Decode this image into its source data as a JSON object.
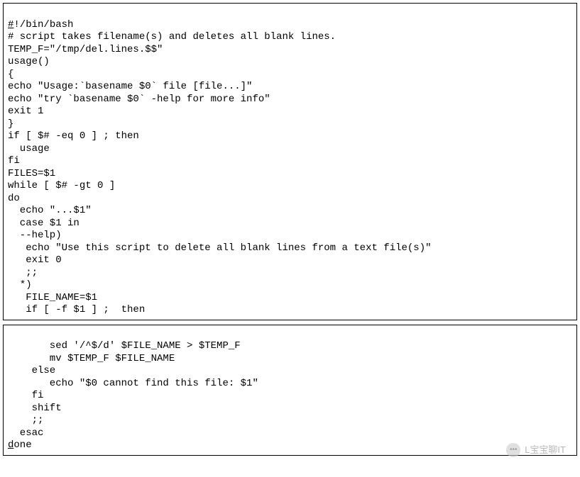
{
  "box1": {
    "l01a": "#",
    "l01b": "!/bin/bash",
    "l02": "# script takes filename(s) and deletes all blank lines.",
    "l03": "TEMP_F=\"/tmp/del.lines.$$\"",
    "l04": "usage()",
    "l05": "{",
    "l06": "echo \"Usage:`basename $0` file [file...]\"",
    "l07": "echo \"try `basename $0` -help for more info\"",
    "l08": "exit 1",
    "l09": "}",
    "l10": "if [ $# -eq 0 ] ; then",
    "l11": "  usage",
    "l12": "fi",
    "l13": "FILES=$1",
    "l14": "while [ $# -gt 0 ]",
    "l15": "do",
    "l16": "  echo \"...$1\"",
    "l17": "  case $1 in",
    "l18": "  --help)",
    "l19": "   echo \"Use this script to delete all blank lines from a text file(s)\"",
    "l20": "   exit 0",
    "l21": "   ;;",
    "l22": "  *)",
    "l23": "   FILE_NAME=$1",
    "l24": "   if [ -f $1 ] ;  then"
  },
  "box2": {
    "l01": "       sed '/^$/d' $FILE_NAME > $TEMP_F",
    "l02": "       mv $TEMP_F $FILE_NAME",
    "l03": "    else",
    "l04": "       echo \"$0 cannot find this file: $1\"",
    "l05": "    fi",
    "l06": "    shift",
    "l07": "    ;;",
    "l08": "  esac",
    "l09a": "d",
    "l09b": "one"
  },
  "watermark": {
    "text": "L宝宝聊IT"
  }
}
